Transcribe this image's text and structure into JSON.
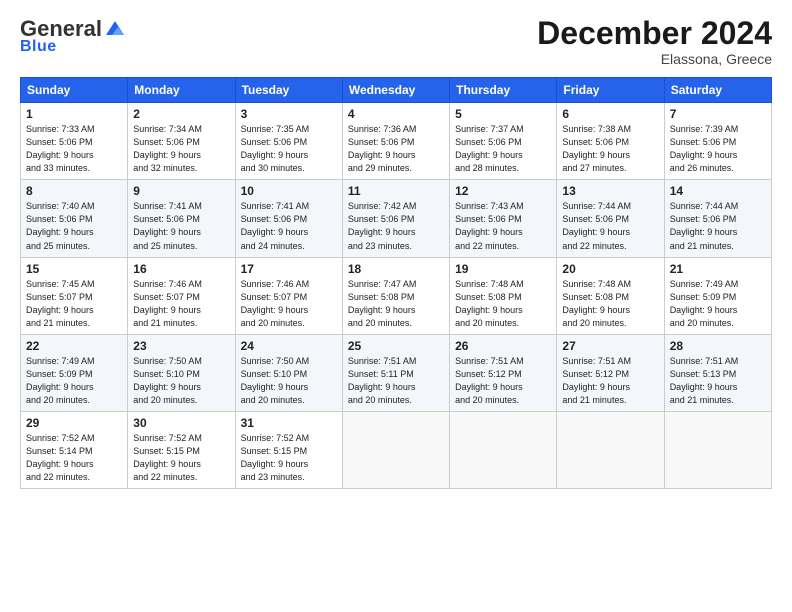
{
  "header": {
    "logo_general": "General",
    "logo_blue": "Blue",
    "month_title": "December 2024",
    "location": "Elassona, Greece"
  },
  "days_of_week": [
    "Sunday",
    "Monday",
    "Tuesday",
    "Wednesday",
    "Thursday",
    "Friday",
    "Saturday"
  ],
  "weeks": [
    [
      {
        "day": "1",
        "lines": [
          "Sunrise: 7:33 AM",
          "Sunset: 5:06 PM",
          "Daylight: 9 hours",
          "and 33 minutes."
        ]
      },
      {
        "day": "2",
        "lines": [
          "Sunrise: 7:34 AM",
          "Sunset: 5:06 PM",
          "Daylight: 9 hours",
          "and 32 minutes."
        ]
      },
      {
        "day": "3",
        "lines": [
          "Sunrise: 7:35 AM",
          "Sunset: 5:06 PM",
          "Daylight: 9 hours",
          "and 30 minutes."
        ]
      },
      {
        "day": "4",
        "lines": [
          "Sunrise: 7:36 AM",
          "Sunset: 5:06 PM",
          "Daylight: 9 hours",
          "and 29 minutes."
        ]
      },
      {
        "day": "5",
        "lines": [
          "Sunrise: 7:37 AM",
          "Sunset: 5:06 PM",
          "Daylight: 9 hours",
          "and 28 minutes."
        ]
      },
      {
        "day": "6",
        "lines": [
          "Sunrise: 7:38 AM",
          "Sunset: 5:06 PM",
          "Daylight: 9 hours",
          "and 27 minutes."
        ]
      },
      {
        "day": "7",
        "lines": [
          "Sunrise: 7:39 AM",
          "Sunset: 5:06 PM",
          "Daylight: 9 hours",
          "and 26 minutes."
        ]
      }
    ],
    [
      {
        "day": "8",
        "lines": [
          "Sunrise: 7:40 AM",
          "Sunset: 5:06 PM",
          "Daylight: 9 hours",
          "and 25 minutes."
        ]
      },
      {
        "day": "9",
        "lines": [
          "Sunrise: 7:41 AM",
          "Sunset: 5:06 PM",
          "Daylight: 9 hours",
          "and 25 minutes."
        ]
      },
      {
        "day": "10",
        "lines": [
          "Sunrise: 7:41 AM",
          "Sunset: 5:06 PM",
          "Daylight: 9 hours",
          "and 24 minutes."
        ]
      },
      {
        "day": "11",
        "lines": [
          "Sunrise: 7:42 AM",
          "Sunset: 5:06 PM",
          "Daylight: 9 hours",
          "and 23 minutes."
        ]
      },
      {
        "day": "12",
        "lines": [
          "Sunrise: 7:43 AM",
          "Sunset: 5:06 PM",
          "Daylight: 9 hours",
          "and 22 minutes."
        ]
      },
      {
        "day": "13",
        "lines": [
          "Sunrise: 7:44 AM",
          "Sunset: 5:06 PM",
          "Daylight: 9 hours",
          "and 22 minutes."
        ]
      },
      {
        "day": "14",
        "lines": [
          "Sunrise: 7:44 AM",
          "Sunset: 5:06 PM",
          "Daylight: 9 hours",
          "and 21 minutes."
        ]
      }
    ],
    [
      {
        "day": "15",
        "lines": [
          "Sunrise: 7:45 AM",
          "Sunset: 5:07 PM",
          "Daylight: 9 hours",
          "and 21 minutes."
        ]
      },
      {
        "day": "16",
        "lines": [
          "Sunrise: 7:46 AM",
          "Sunset: 5:07 PM",
          "Daylight: 9 hours",
          "and 21 minutes."
        ]
      },
      {
        "day": "17",
        "lines": [
          "Sunrise: 7:46 AM",
          "Sunset: 5:07 PM",
          "Daylight: 9 hours",
          "and 20 minutes."
        ]
      },
      {
        "day": "18",
        "lines": [
          "Sunrise: 7:47 AM",
          "Sunset: 5:08 PM",
          "Daylight: 9 hours",
          "and 20 minutes."
        ]
      },
      {
        "day": "19",
        "lines": [
          "Sunrise: 7:48 AM",
          "Sunset: 5:08 PM",
          "Daylight: 9 hours",
          "and 20 minutes."
        ]
      },
      {
        "day": "20",
        "lines": [
          "Sunrise: 7:48 AM",
          "Sunset: 5:08 PM",
          "Daylight: 9 hours",
          "and 20 minutes."
        ]
      },
      {
        "day": "21",
        "lines": [
          "Sunrise: 7:49 AM",
          "Sunset: 5:09 PM",
          "Daylight: 9 hours",
          "and 20 minutes."
        ]
      }
    ],
    [
      {
        "day": "22",
        "lines": [
          "Sunrise: 7:49 AM",
          "Sunset: 5:09 PM",
          "Daylight: 9 hours",
          "and 20 minutes."
        ]
      },
      {
        "day": "23",
        "lines": [
          "Sunrise: 7:50 AM",
          "Sunset: 5:10 PM",
          "Daylight: 9 hours",
          "and 20 minutes."
        ]
      },
      {
        "day": "24",
        "lines": [
          "Sunrise: 7:50 AM",
          "Sunset: 5:10 PM",
          "Daylight: 9 hours",
          "and 20 minutes."
        ]
      },
      {
        "day": "25",
        "lines": [
          "Sunrise: 7:51 AM",
          "Sunset: 5:11 PM",
          "Daylight: 9 hours",
          "and 20 minutes."
        ]
      },
      {
        "day": "26",
        "lines": [
          "Sunrise: 7:51 AM",
          "Sunset: 5:12 PM",
          "Daylight: 9 hours",
          "and 20 minutes."
        ]
      },
      {
        "day": "27",
        "lines": [
          "Sunrise: 7:51 AM",
          "Sunset: 5:12 PM",
          "Daylight: 9 hours",
          "and 21 minutes."
        ]
      },
      {
        "day": "28",
        "lines": [
          "Sunrise: 7:51 AM",
          "Sunset: 5:13 PM",
          "Daylight: 9 hours",
          "and 21 minutes."
        ]
      }
    ],
    [
      {
        "day": "29",
        "lines": [
          "Sunrise: 7:52 AM",
          "Sunset: 5:14 PM",
          "Daylight: 9 hours",
          "and 22 minutes."
        ]
      },
      {
        "day": "30",
        "lines": [
          "Sunrise: 7:52 AM",
          "Sunset: 5:15 PM",
          "Daylight: 9 hours",
          "and 22 minutes."
        ]
      },
      {
        "day": "31",
        "lines": [
          "Sunrise: 7:52 AM",
          "Sunset: 5:15 PM",
          "Daylight: 9 hours",
          "and 23 minutes."
        ]
      },
      null,
      null,
      null,
      null
    ]
  ]
}
